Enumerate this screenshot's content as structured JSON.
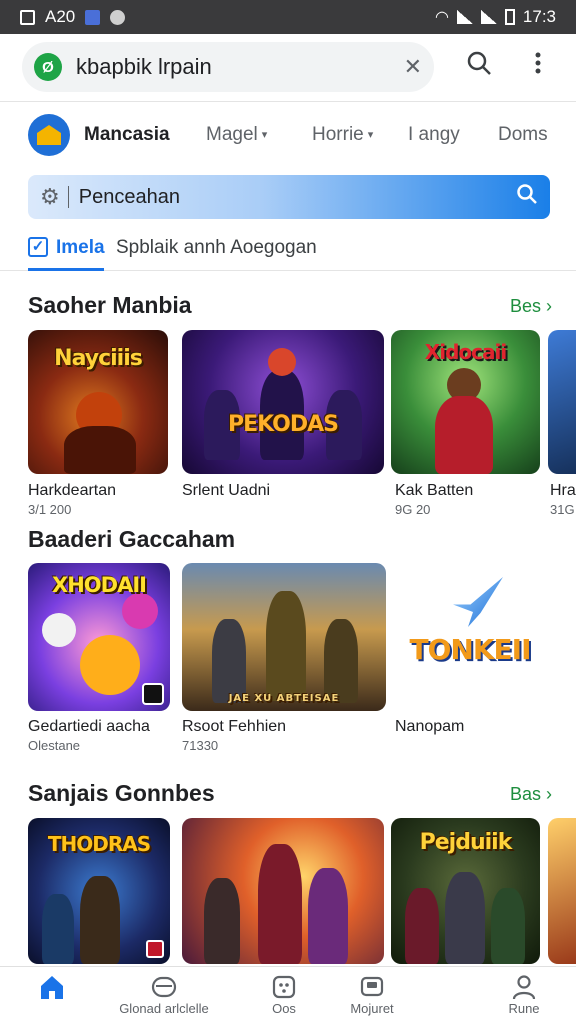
{
  "status": {
    "left_text": "A20",
    "time": "17:3"
  },
  "browser": {
    "url": "kbapbik lrpain",
    "site_icon": "Ø"
  },
  "app": {
    "brand": "Mancasia",
    "nav": [
      "Magel",
      "Horrie",
      "I angy",
      "Doms"
    ],
    "search_placeholder": "Penceahan",
    "filter_tab": "Imela",
    "filter_sub": "Spblaik annh Aoegogan"
  },
  "sections": [
    {
      "title": "Saoher Manbia",
      "more": "Bes",
      "games": [
        {
          "title": "Harkdeartan",
          "meta": "3/1 200",
          "art": "Nayciiis"
        },
        {
          "title": "Srlent Uadni",
          "meta": "",
          "art": "PEKODAS"
        },
        {
          "title": "Kak Batten",
          "meta": "9G 20",
          "art": "Xidocaii"
        },
        {
          "title": "Hral",
          "meta": "31G",
          "art": ""
        }
      ]
    },
    {
      "title": "Baaderi Gaccaham",
      "more": "",
      "games": [
        {
          "title": "Gedartiedi aacha",
          "meta": "Olestane",
          "art": "XHODAII"
        },
        {
          "title": "Rsoot Fehhien",
          "meta": "71330",
          "art": "JAE XU ABTEISAE"
        },
        {
          "title": "Nanopam",
          "meta": "",
          "art": "TONKEII"
        }
      ]
    },
    {
      "title": "Sanjais Gonnbes",
      "more": "Bas",
      "games": [
        {
          "title": "",
          "meta": "",
          "art": "THODRAS"
        },
        {
          "title": "",
          "meta": "",
          "art": ""
        },
        {
          "title": "",
          "meta": "",
          "art": "Pejduiik"
        }
      ]
    }
  ],
  "bottom_nav": [
    {
      "label": "",
      "icon": "home-icon",
      "active": true
    },
    {
      "label": "Glonad arlclelle",
      "icon": "gamepad-icon"
    },
    {
      "label": "Oos",
      "icon": "apps-icon"
    },
    {
      "label": "Mojuret",
      "icon": "movies-icon"
    },
    {
      "label": "Rune",
      "icon": "person-icon"
    }
  ],
  "colors": {
    "accent": "#1a73e8",
    "green": "#1e8e3e",
    "status_bar": "#3a3a3c"
  }
}
